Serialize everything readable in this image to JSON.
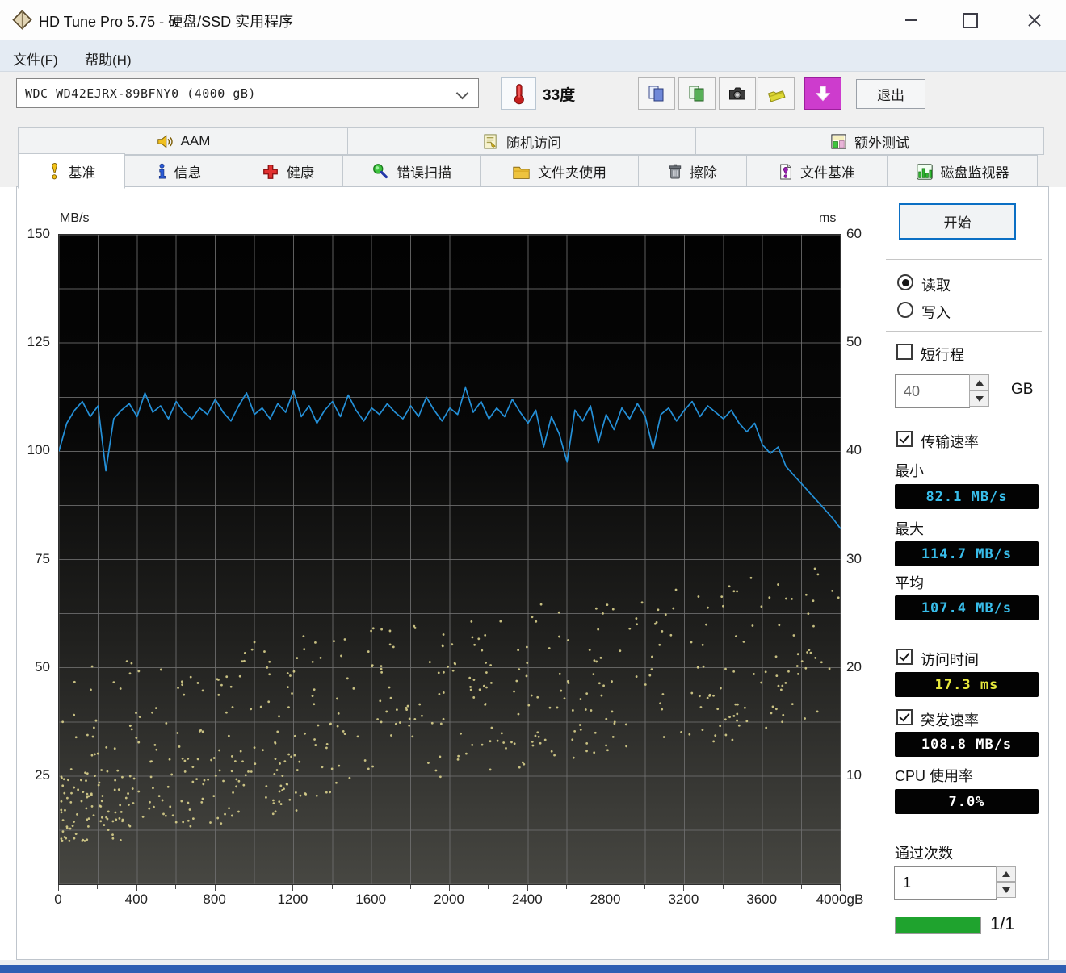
{
  "window": {
    "title": "HD Tune Pro 5.75 - 硬盘/SSD 实用程序"
  },
  "menu": {
    "items": [
      {
        "label": "文件(F)"
      },
      {
        "label": "帮助(H)"
      }
    ]
  },
  "toolbar": {
    "drive_select": "WDC WD42EJRX-89BFNY0 (4000 gB)",
    "temperature": "33度",
    "exit_label": "退出"
  },
  "tabs": {
    "upper": [
      {
        "label": "AAM"
      },
      {
        "label": "随机访问"
      },
      {
        "label": "额外测试"
      }
    ],
    "lower": [
      {
        "label": "基准",
        "active": true
      },
      {
        "label": "信息"
      },
      {
        "label": "健康"
      },
      {
        "label": "错误扫描"
      },
      {
        "label": "文件夹使用"
      },
      {
        "label": "擦除"
      },
      {
        "label": "文件基准"
      },
      {
        "label": "磁盘监视器"
      }
    ]
  },
  "panel": {
    "start_button": "开始",
    "radio_read": {
      "label": "读取",
      "checked": true
    },
    "radio_write": {
      "label": "写入",
      "checked": false
    },
    "short_stroke": {
      "label": "短行程",
      "checked": false,
      "value": "40",
      "unit": "GB"
    },
    "transfer": {
      "label": "传输速率",
      "checked": true,
      "min": {
        "label": "最小",
        "value": "82.1 MB/s"
      },
      "max": {
        "label": "最大",
        "value": "114.7 MB/s"
      },
      "avg": {
        "label": "平均",
        "value": "107.4 MB/s"
      }
    },
    "access_time": {
      "label": "访问时间",
      "checked": true,
      "value": "17.3 ms"
    },
    "burst": {
      "label": "突发速率",
      "checked": true,
      "value": "108.8 MB/s"
    },
    "cpu": {
      "label": "CPU 使用率",
      "value": "7.0%"
    },
    "pass_count": {
      "label": "通过次数",
      "value": "1"
    },
    "progress": {
      "label": "1/1",
      "percent": 100
    }
  },
  "colors": {
    "lcd_cyan": "#38bdea",
    "lcd_yellow": "#e6e83c",
    "lcd_white": "#ffffff",
    "progress_green": "#1fa32e",
    "bottom_bar_blue": "#2f5fb3"
  },
  "chart_data": {
    "type": "line+scatter",
    "x_axis": {
      "min": 0,
      "max": 4000,
      "tick_step": 400,
      "minor_step": 200,
      "labels": [
        "0",
        "400",
        "800",
        "1200",
        "1600",
        "2000",
        "2400",
        "2800",
        "3200",
        "3600",
        "4000gB"
      ]
    },
    "y_left": {
      "label": "MB/s",
      "min": 0,
      "max": 150,
      "ticks": [
        150,
        125,
        100,
        75,
        50,
        25
      ],
      "grid_step": 12.5
    },
    "y_right": {
      "label": "ms",
      "min": 0,
      "max": 60,
      "ticks": [
        60,
        50,
        40,
        30,
        20,
        10
      ]
    },
    "grid_color": "#6f6f6f",
    "series": [
      {
        "name": "transfer-rate",
        "type": "line",
        "axis": "left",
        "color": "#2490d8",
        "x_start": 0,
        "x_step": 40,
        "values": [
          100.0,
          106.5,
          109.5,
          111.5,
          108.0,
          110.5,
          95.5,
          107.5,
          109.5,
          111.0,
          108.0,
          113.5,
          109.0,
          110.5,
          107.5,
          111.5,
          109.0,
          107.5,
          110.0,
          108.5,
          112.0,
          109.0,
          107.0,
          110.5,
          113.5,
          108.5,
          110.0,
          107.5,
          111.0,
          109.0,
          114.0,
          108.0,
          110.5,
          106.5,
          109.5,
          111.5,
          108.0,
          113.0,
          109.5,
          107.0,
          110.0,
          108.5,
          111.0,
          109.0,
          107.5,
          110.5,
          108.0,
          112.5,
          109.5,
          107.0,
          110.0,
          108.5,
          114.7,
          109.0,
          111.5,
          107.5,
          110.0,
          108.0,
          112.0,
          109.0,
          106.5,
          109.5,
          101.0,
          108.0,
          104.0,
          97.5,
          109.5,
          107.0,
          110.5,
          102.0,
          108.5,
          105.0,
          110.0,
          107.5,
          111.0,
          108.0,
          100.5,
          108.5,
          110.0,
          107.0,
          109.5,
          111.5,
          108.0,
          110.5,
          109.0,
          107.5,
          109.5,
          106.5,
          104.5,
          106.5,
          101.5,
          99.5,
          101.0,
          96.5,
          94.5,
          92.5,
          90.5,
          88.5,
          86.5,
          84.5,
          82.1
        ]
      },
      {
        "name": "access-time",
        "type": "scatter",
        "axis": "right",
        "color": "#d6cd8a",
        "dot_radius": 1.4,
        "generator": {
          "seed": 1337,
          "bands": [
            {
              "count": 440,
              "x_min": 10,
              "x_max": 3990,
              "x_pow": 1,
              "ms_start": 12.5,
              "ms_end": 22.0,
              "noise": 7.5,
              "clip_min": 4.5,
              "clip_max": 33.5
            },
            {
              "count": 150,
              "x_min": 10,
              "x_max": 1350,
              "x_pow": 1.5,
              "ms_start": 6.5,
              "ms_end": 10.5,
              "noise": 3.5,
              "clip_min": 4.0,
              "clip_max": 14.5
            }
          ]
        }
      }
    ]
  }
}
